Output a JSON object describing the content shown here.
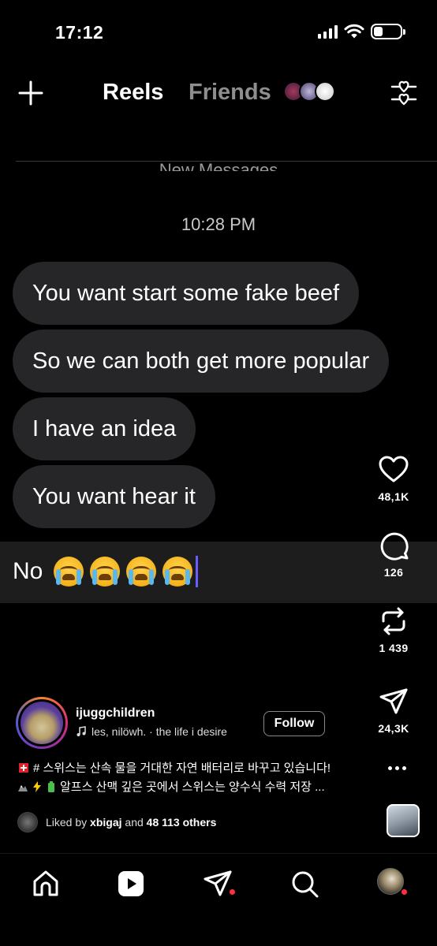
{
  "status_bar": {
    "time": "17:12",
    "battery_level": 0.25,
    "icons": [
      "signal-icon",
      "wifi-icon",
      "battery-icon"
    ]
  },
  "top_nav": {
    "tabs": [
      {
        "label": "Reels",
        "active": true
      },
      {
        "label": "Friends",
        "active": false
      }
    ],
    "icons": [
      "plus-icon",
      "filter-heart-icon"
    ]
  },
  "chat": {
    "new_messages_label": "New Messages",
    "time": "10:28 PM",
    "messages": [
      "You want start some fake beef",
      "So we can both get more popular",
      "I have an idea",
      "You want hear it"
    ],
    "input_text": "No",
    "input_emojis": [
      "loudly-crying-face",
      "loudly-crying-face",
      "loudly-crying-face",
      "loudly-crying-face"
    ]
  },
  "actions": {
    "likes": "48,1K",
    "comments": "126",
    "reposts": "1 439",
    "shares": "24,3K"
  },
  "post": {
    "username": "ijuggchildren",
    "music": "les, nilöwh. · the life i desire",
    "follow_label": "Follow",
    "caption_line1": "# 스위스는 산속 물을 거대한 자연 배터리로 바꾸고 있습니다!",
    "caption_line2": "알프스 산맥 깊은 곳에서 스위스는 양수식 수력 저장 ...",
    "liked_by_prefix": "Liked by",
    "liked_by_user": "xbigaj",
    "liked_by_and": "and",
    "liked_by_others": "48 113 others"
  },
  "bottom_nav": {
    "items": [
      "home-icon",
      "reels-icon",
      "messages-icon",
      "search-icon",
      "profile-avatar"
    ]
  },
  "colors": {
    "background": "#000000",
    "bubble": "#262628",
    "input_bar": "#1d1d1e",
    "notification_dot": "#ff3040",
    "cursor": "#6a5cff"
  }
}
